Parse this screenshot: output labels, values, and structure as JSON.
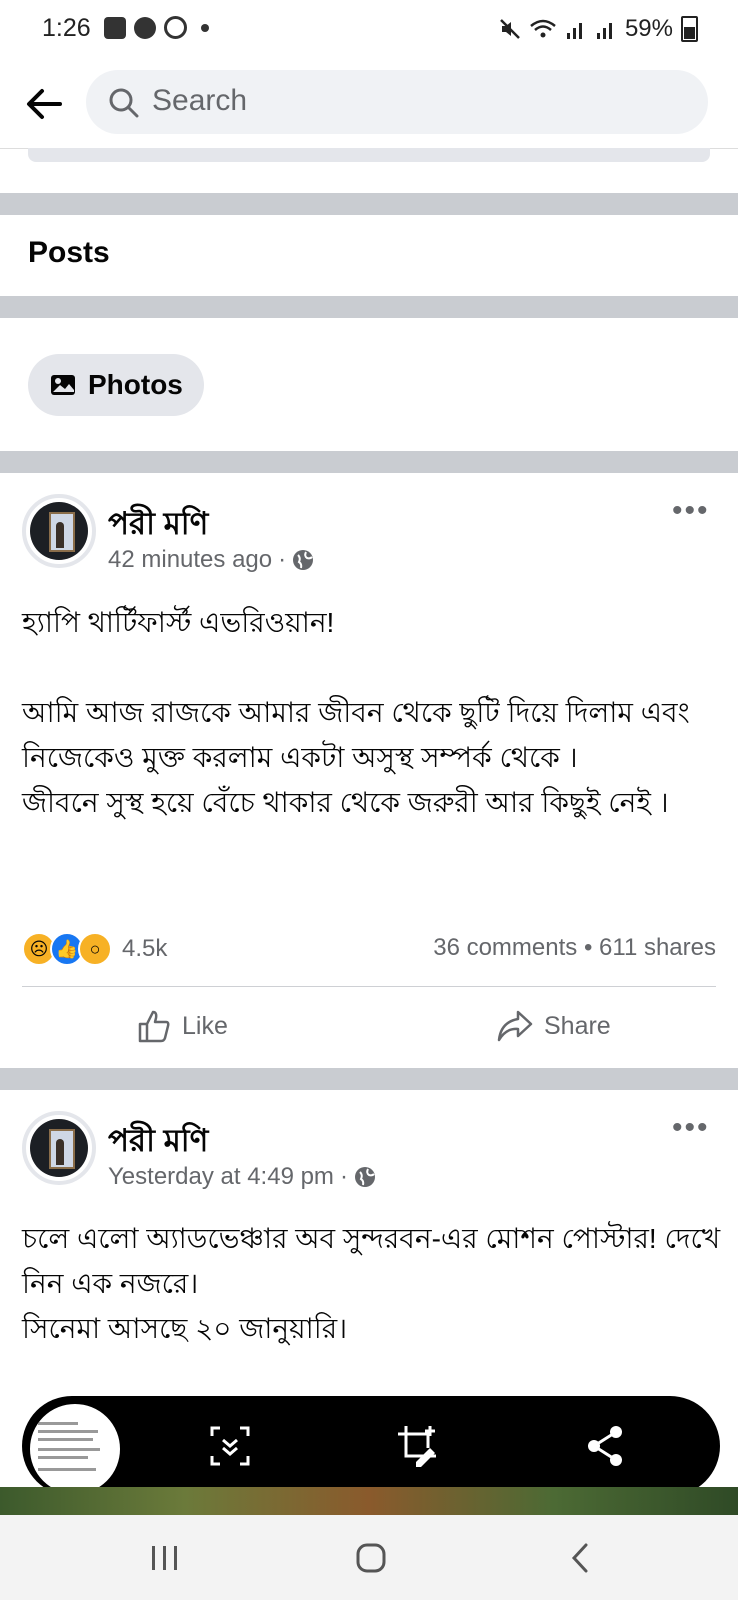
{
  "status_bar": {
    "time": "1:26",
    "battery": "59%",
    "left_icons": [
      "gallery-icon",
      "facebook-icon",
      "whatsapp-icon"
    ],
    "right_icons": [
      "mute-icon",
      "wifi-icon",
      "signal-icon",
      "signal-icon"
    ]
  },
  "header": {
    "search_placeholder": "Search"
  },
  "section": {
    "title": "Posts",
    "chip_label": "Photos"
  },
  "posts": [
    {
      "author": "পরী মণি",
      "time": "42 minutes ago",
      "privacy_icon": "globe-icon",
      "text": "হ্যাপি থার্টিফার্স্ট এভরিওয়ান!\n\nআমি আজ রাজকে আমার জীবন থেকে ছুটি দিয়ে দিলাম এবং নিজেকেও মুক্ত করলাম একটা অসুস্থ সম্পর্ক থেকে ।\nজীবনে সুস্থ হয়ে বেঁচে থাকার থেকে জরুরী আর কিছুই নেই ।",
      "reactions_count": "4.5k",
      "comments": "36 comments",
      "shares": "611 shares",
      "like_label": "Like",
      "share_label": "Share"
    },
    {
      "author": "পরী মণি",
      "time": "Yesterday at 4:49 pm",
      "privacy_icon": "globe-icon",
      "text": "চলে এলো অ্যাডভেঞ্চার অব সুন্দরবন-এর মোশন পোস্টার! দেখে নিন এক নজরে।\nসিনেমা আসছে ২০ জানুয়ারি।"
    }
  ],
  "capture_toolbar": {
    "buttons": [
      "scroll-capture-icon",
      "crop-edit-icon",
      "share-icon"
    ]
  },
  "nav_bar": {
    "buttons": [
      "recent-apps-icon",
      "home-icon",
      "back-icon"
    ]
  },
  "colors": {
    "separator": "#c9ccd1",
    "chip_bg": "#e4e6eb",
    "secondary_text": "#65676b",
    "like_reaction": "#1877f2",
    "emoji_yellow": "#f7b125"
  }
}
